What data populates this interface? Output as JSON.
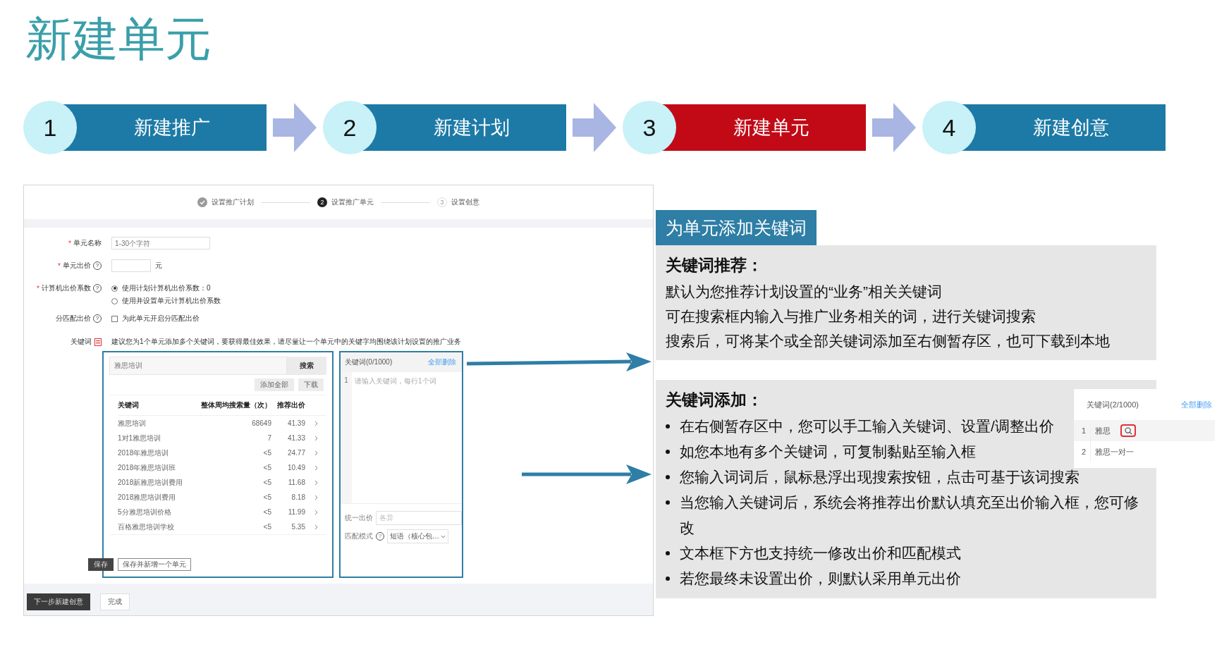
{
  "slide_title": "新建单元",
  "steps": [
    {
      "number": "1",
      "label": "新建推广",
      "selected": false
    },
    {
      "number": "2",
      "label": "新建计划",
      "selected": false
    },
    {
      "number": "3",
      "label": "新建单元",
      "selected": true
    },
    {
      "number": "4",
      "label": "新建创意",
      "selected": false
    }
  ],
  "screenshot": {
    "wizard_steps": [
      {
        "kind": "done",
        "label": "设置推广计划"
      },
      {
        "kind": "current",
        "number": "2",
        "label": "设置推广单元"
      },
      {
        "kind": "pending",
        "number": "3",
        "label": "设置创意"
      }
    ],
    "form": [
      {
        "kind": "text",
        "label": "单元名称",
        "required_mark": "*",
        "placeholder": "1-30个字符"
      },
      {
        "kind": "price",
        "label": "单元出价",
        "required_mark": "*",
        "help": "?",
        "unit": "元"
      },
      {
        "kind": "radio",
        "label": "计算机出价系数",
        "required_mark": "*",
        "help": "?",
        "options": [
          {
            "label": "使用计划计算机出价系数：0",
            "selected": true
          },
          {
            "label": "使用并设置单元计算机出价系数",
            "selected": false
          }
        ]
      },
      {
        "kind": "checkbox",
        "label": "分匹配出价",
        "help": "?",
        "option": {
          "label": "为此单元开启分匹配出价",
          "checked": false
        }
      }
    ],
    "keywords": {
      "label": "关键词",
      "hint": "建议您为1个单元添加多个关键词，要获得最佳效果，请尽量让一个单元中的关键字均围绕该计划设置的推广业务",
      "search": {
        "value": "雅思培训",
        "button": "搜索"
      },
      "actions": [
        "添加全部",
        "下载"
      ],
      "columns": [
        "关键词",
        "整体周均搜索量（次）",
        "推荐出价"
      ],
      "rows": [
        [
          "雅思培训",
          "68649",
          "41.39"
        ],
        [
          "1对1雅思培训",
          "7",
          "41.33"
        ],
        [
          "2018年雅思培训",
          "<5",
          "24.77"
        ],
        [
          "2018年雅思培训班",
          "<5",
          "10.49"
        ],
        [
          "2018新雅思培训费用",
          "<5",
          "11.68"
        ],
        [
          "2018雅思培训费用",
          "<5",
          "8.18"
        ],
        [
          "5分雅思培训价格",
          "<5",
          "11.99"
        ],
        [
          "百格雅思培训学校",
          "<5",
          "5.35"
        ]
      ],
      "save_buttons": [
        "保存",
        "保存并新增一个单元"
      ],
      "staging": {
        "title": "关键词(0/1000)",
        "clear_link": "全部删除",
        "line_number": "1",
        "placeholder": "请输入关键词，每行1个词",
        "price_label": "统一出价",
        "price_placeholder": "各异",
        "match_label": "匹配模式",
        "match_help": "?",
        "match_value": "短语（核心包…"
      }
    },
    "footer_buttons": [
      "下一步新建创意",
      "完成"
    ]
  },
  "callout": {
    "title": "为单元添加关键词",
    "recommend": {
      "heading": "关键词推荐：",
      "lines": [
        "默认为您推荐计划设置的“业务”相关关键词",
        "可在搜索框内输入与推广业务相关的词，进行关键词搜索",
        "搜索后，可将某个或全部关键词添加至右侧暂存区，也可下载到本地"
      ]
    },
    "add": {
      "heading": "关键词添加：",
      "bullets": [
        "在右侧暂存区中，您可以手工输入关键词、设置/调整出价",
        "如您本地有多个关键词，可复制黏贴至输入框",
        "您输入词词后，鼠标悬浮出现搜索按钮，点击可基于该词搜索",
        "当您输入关键词后，系统会将推荐出价默认填充至出价输入框，您可修改",
        "文本框下方也支持统一修改出价和匹配模式",
        "若您最终未设置出价，则默认采用单元出价"
      ]
    },
    "example": {
      "title": "关键词(2/1000)",
      "clear_link": "全部删除",
      "rows": [
        {
          "number": "1",
          "text": "雅思",
          "highlighted": true
        },
        {
          "number": "2",
          "text": "雅思一对一",
          "highlighted": false
        }
      ]
    }
  }
}
